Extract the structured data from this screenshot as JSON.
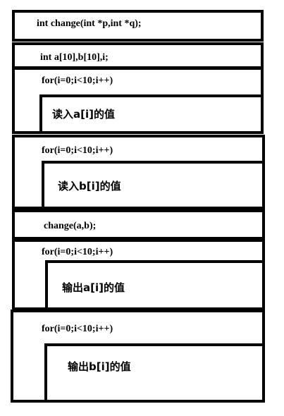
{
  "diagram": {
    "declare_func": "int change(int *p,int *q);",
    "declare_vars": "int a[10],b[10],i;",
    "loop1": {
      "header": "for(i=0;i<10;i++)",
      "body": "读入a[i]的值"
    },
    "loop2": {
      "header": "for(i=0;i<10;i++)",
      "body": "读入b[i]的值"
    },
    "call": "change(a,b);",
    "loop3": {
      "header": "for(i=0;i<10;i++)",
      "body": "输出a[i]的值"
    },
    "loop4": {
      "header": "for(i=0;i<10;i++)",
      "body": "输出b[i]的值"
    }
  }
}
